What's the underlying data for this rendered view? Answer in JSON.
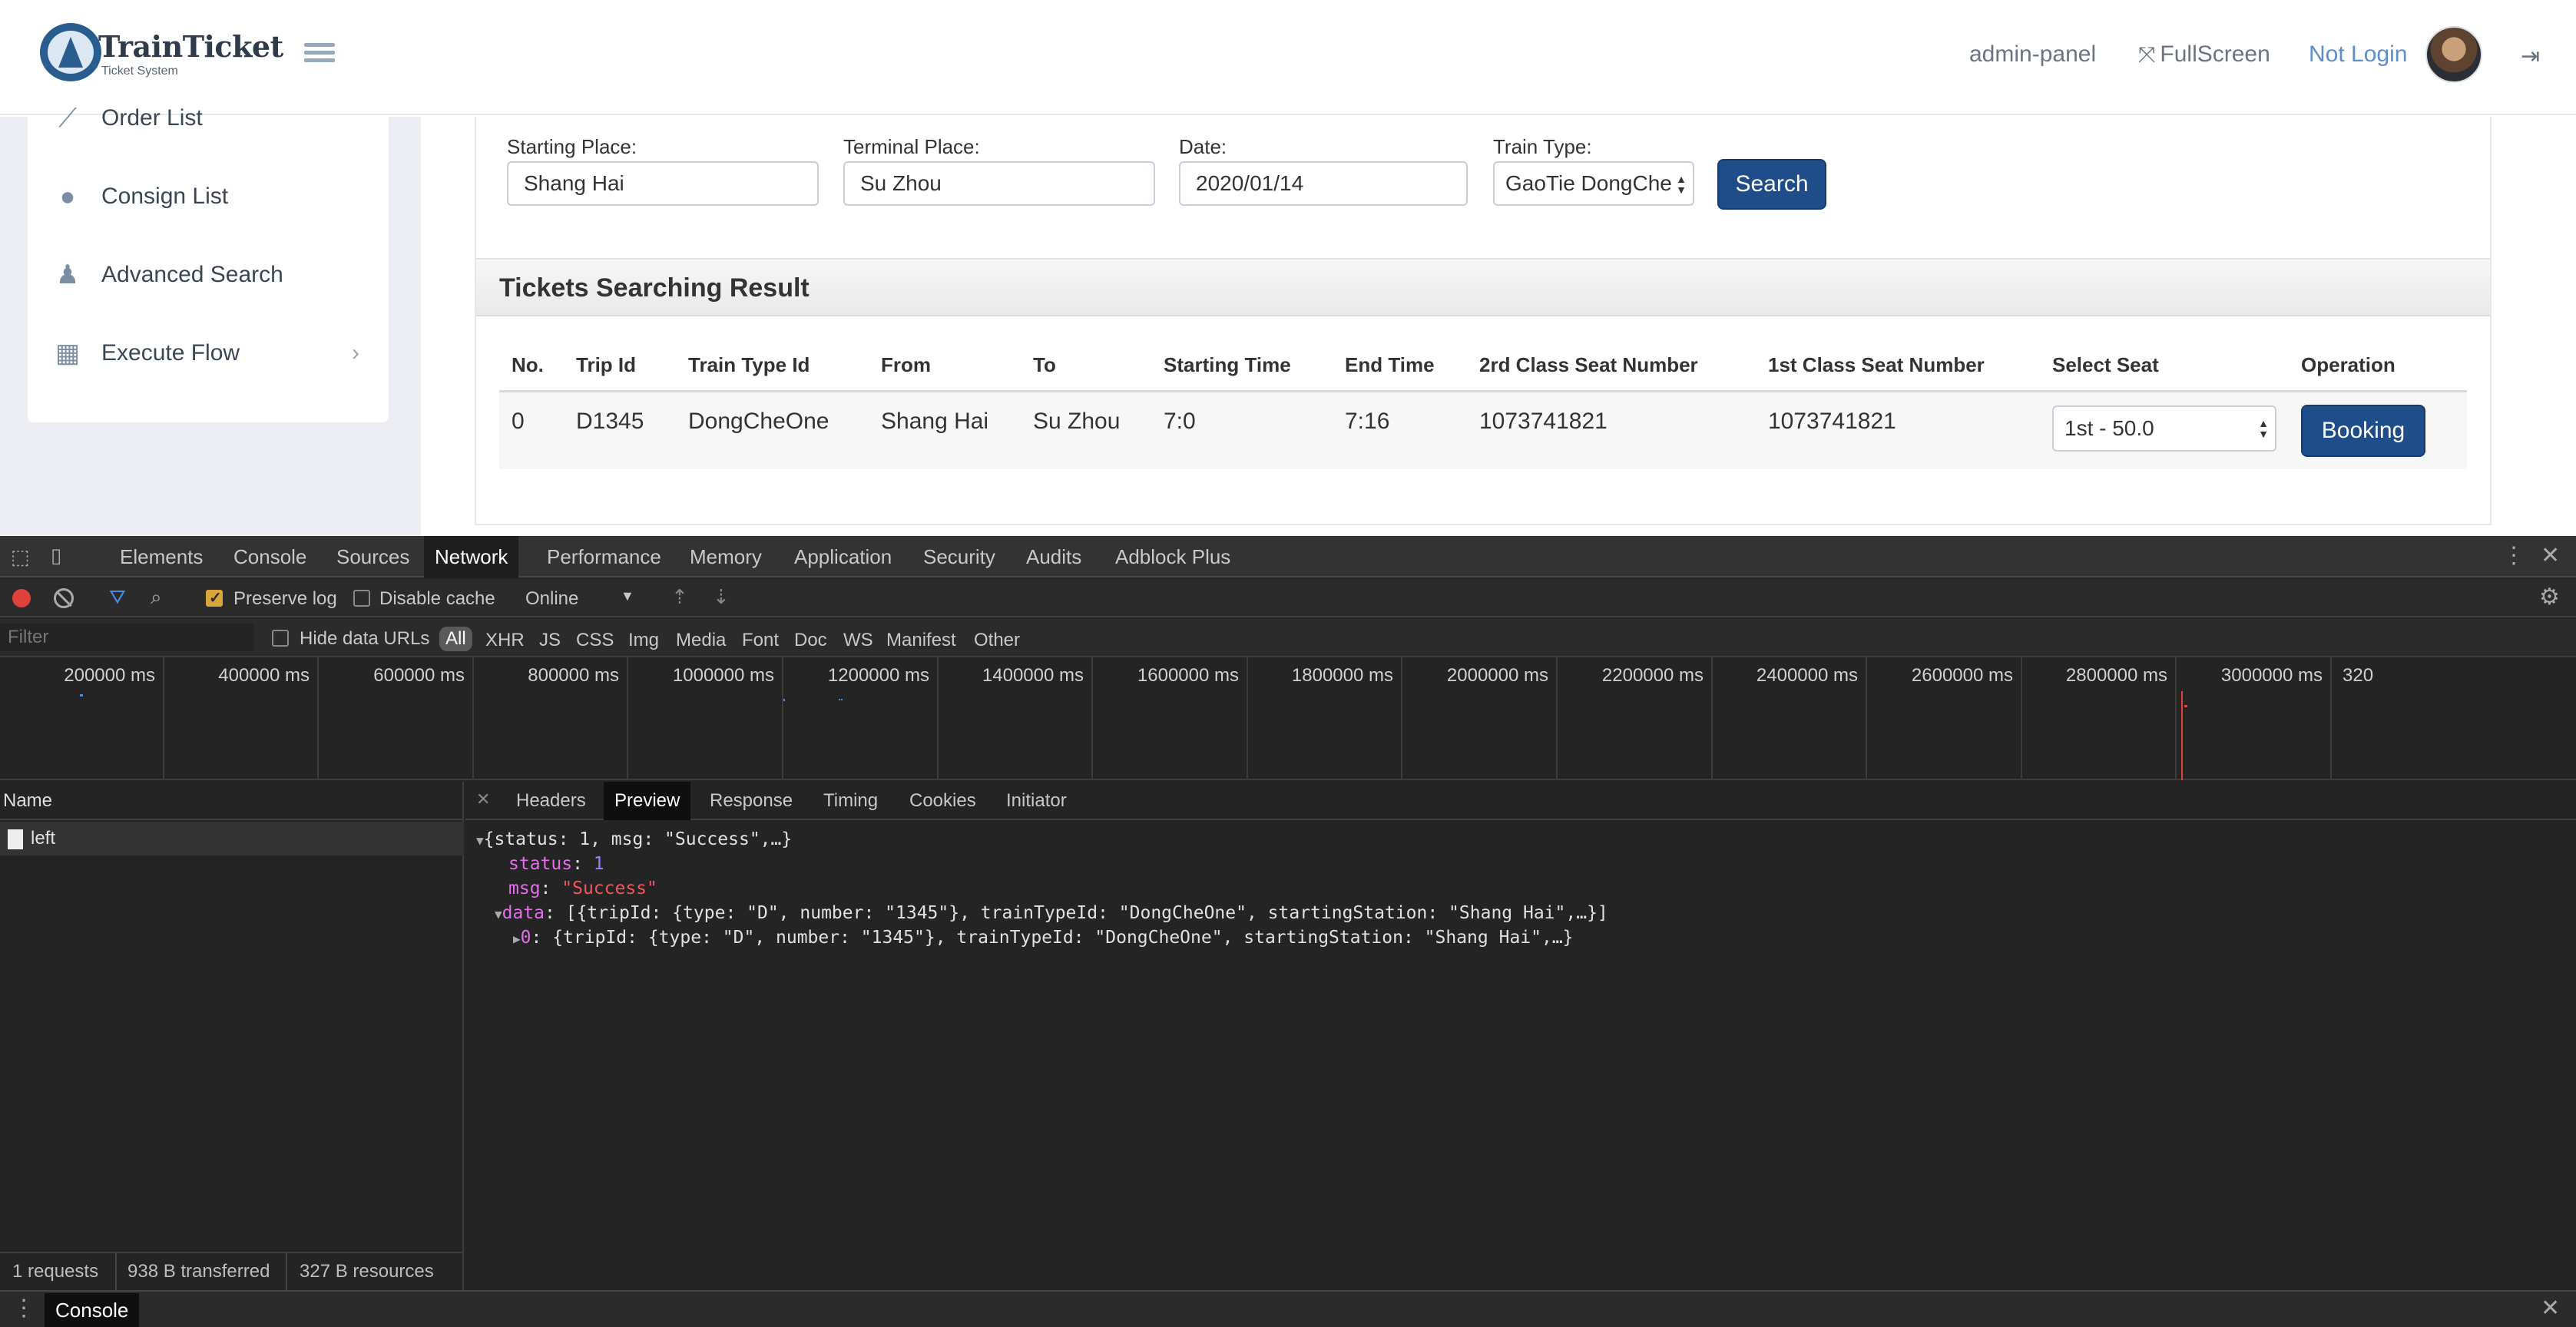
{
  "app": {
    "brand_title": "TrainTicket",
    "brand_subtitle": "Ticket System",
    "header": {
      "admin_label": "admin-panel",
      "fullscreen_label": "FullScreen",
      "login_label": "Not Login"
    },
    "sidebar": [
      {
        "label": "Order List",
        "icon": "chart-icon"
      },
      {
        "label": "Consign List",
        "icon": "globe-icon"
      },
      {
        "label": "Advanced Search",
        "icon": "users-icon"
      },
      {
        "label": "Execute Flow",
        "icon": "table-icon"
      }
    ],
    "search": {
      "starting_label": "Starting Place:",
      "starting_value": "Shang Hai",
      "terminal_label": "Terminal Place:",
      "terminal_value": "Su Zhou",
      "date_label": "Date:",
      "date_value": "2020/01/14",
      "train_type_label": "Train Type:",
      "train_type_value": "GaoTie DongChe",
      "search_button": "Search"
    },
    "results": {
      "title": "Tickets Searching Result",
      "columns": [
        "No.",
        "Trip Id",
        "Train Type Id",
        "From",
        "To",
        "Starting Time",
        "End Time",
        "2rd Class Seat Number",
        "1st Class Seat Number",
        "Select Seat",
        "Operation"
      ],
      "rows": [
        {
          "no": "0",
          "trip_id": "D1345",
          "train_type": "DongCheOne",
          "from": "Shang Hai",
          "to": "Su Zhou",
          "start": "7:0",
          "end": "7:16",
          "second_seats": "1073741821",
          "first_seats": "1073741821",
          "seat_select": "1st - 50.0",
          "action": "Booking"
        }
      ]
    }
  },
  "devtools": {
    "tabs": [
      "Elements",
      "Console",
      "Sources",
      "Network",
      "Performance",
      "Memory",
      "Application",
      "Security",
      "Audits",
      "Adblock Plus"
    ],
    "active_tab": "Network",
    "toolbar": {
      "preserve_log": "Preserve log",
      "disable_cache": "Disable cache",
      "throttle": "Online"
    },
    "filter": {
      "placeholder": "Filter",
      "hide_data_urls": "Hide data URLs",
      "types": [
        "All",
        "XHR",
        "JS",
        "CSS",
        "Img",
        "Media",
        "Font",
        "Doc",
        "WS",
        "Manifest",
        "Other"
      ]
    },
    "timeline_labels": [
      "200000 ms",
      "400000 ms",
      "600000 ms",
      "800000 ms",
      "1000000 ms",
      "1200000 ms",
      "1400000 ms",
      "1600000 ms",
      "1800000 ms",
      "2000000 ms",
      "2200000 ms",
      "2400000 ms",
      "2600000 ms",
      "2800000 ms",
      "3000000 ms",
      "320"
    ],
    "name_header": "Name",
    "requests": [
      {
        "name": "left"
      }
    ],
    "status": {
      "requests": "1 requests",
      "transferred": "938 B transferred",
      "resources": "327 B resources"
    },
    "detail_tabs": [
      "Headers",
      "Preview",
      "Response",
      "Timing",
      "Cookies",
      "Initiator"
    ],
    "active_detail_tab": "Preview",
    "preview": {
      "root": "{status: 1, msg: \"Success\",…}",
      "status_key": "status",
      "status_val": "1",
      "msg_key": "msg",
      "msg_val": "\"Success\"",
      "data_key": "data",
      "data_val": "[{tripId: {type: \"D\", number: \"1345\"}, trainTypeId: \"DongCheOne\", startingStation: \"Shang Hai\",…}]",
      "item_key": "0",
      "item_val": "{tripId: {type: \"D\", number: \"1345\"}, trainTypeId: \"DongCheOne\", startingStation: \"Shang Hai\",…}"
    },
    "drawer_tab": "Console"
  }
}
